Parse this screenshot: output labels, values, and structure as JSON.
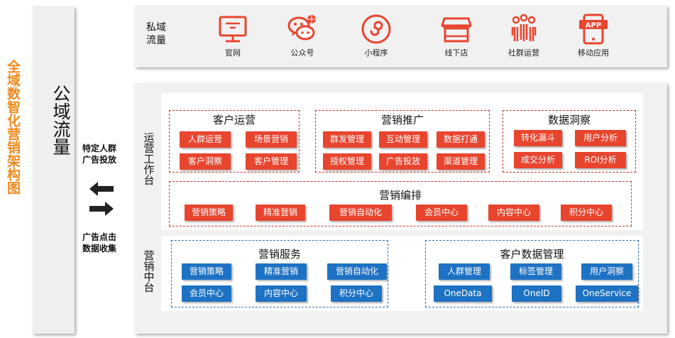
{
  "side_title": "全域数智化营销架构图",
  "public_traffic": "公域流量",
  "left_labels": {
    "targeted": [
      "特定人群",
      "广告投放"
    ],
    "collect": [
      "广告点击",
      "数据收集"
    ]
  },
  "private": {
    "label": [
      "私域",
      "流量"
    ],
    "channels": [
      {
        "label": "官网",
        "icon": "monitor-icon"
      },
      {
        "label": "公众号",
        "icon": "wechat-icon"
      },
      {
        "label": "小程序",
        "icon": "miniprogram-icon"
      },
      {
        "label": "线下店",
        "icon": "store-icon"
      },
      {
        "label": "社群运营",
        "icon": "community-icon"
      },
      {
        "label": "移动应用",
        "icon": "app-icon"
      }
    ],
    "app_badge": "APP"
  },
  "ops_platform": {
    "label": "运营工作台",
    "customer_ops": {
      "title": "客户运营",
      "items": [
        "人群运营",
        "场景营销",
        "客户洞察",
        "客户管理"
      ]
    },
    "marketing_promo": {
      "title": "营销推广",
      "items": [
        "群发管理",
        "互动管理",
        "数据打通",
        "授权管理",
        "广告投放",
        "渠道管理"
      ]
    },
    "data_insight": {
      "title": "数据洞察",
      "items": [
        "转化漏斗",
        "用户分析",
        "成交分析",
        "ROI分析"
      ]
    },
    "orchestration": {
      "title": "营销编排",
      "items": [
        "营销策略",
        "精准营销",
        "营销自动化",
        "会员中心",
        "内容中心",
        "积分中心"
      ]
    }
  },
  "marketing_center": {
    "label": "营销中台",
    "services": {
      "title": "营销服务",
      "items": [
        "营销策略",
        "精准营销",
        "营销自动化",
        "会员中心",
        "内容中心",
        "积分中心"
      ]
    },
    "cdm": {
      "title": "客户数据管理",
      "items": [
        "人群管理",
        "标签管理",
        "用户洞察",
        "OneData",
        "OneID",
        "OneService"
      ]
    }
  },
  "colors": {
    "accent_orange": "#ef8a1f",
    "red": "#e8452f",
    "blue": "#1e72c4"
  }
}
